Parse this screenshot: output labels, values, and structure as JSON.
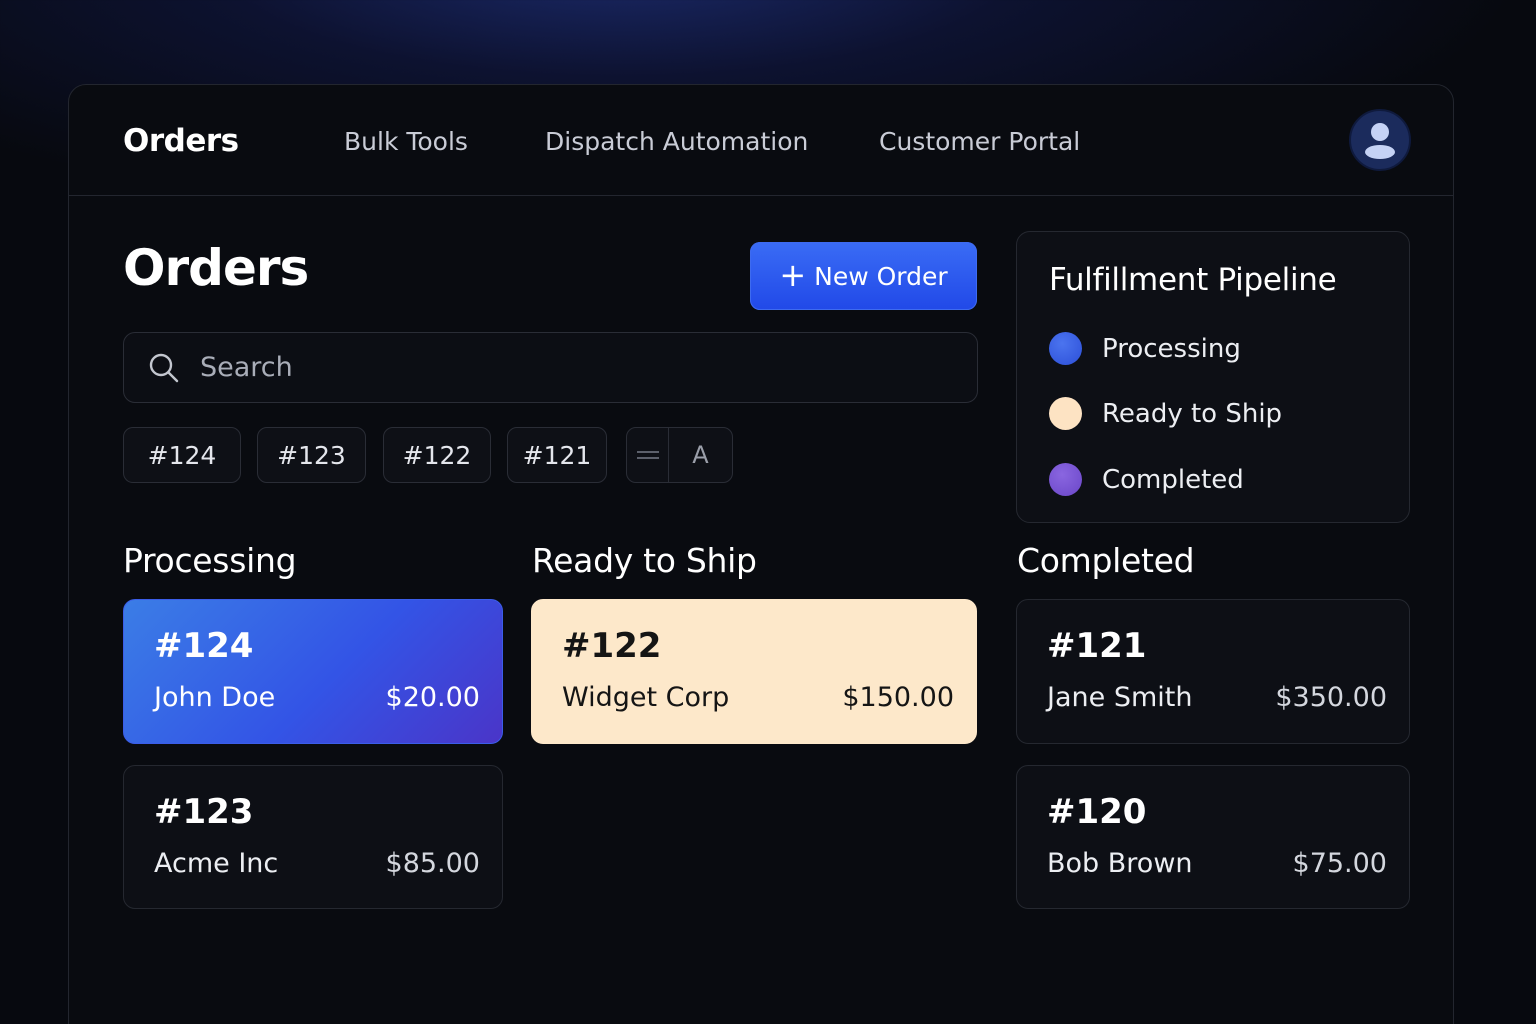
{
  "nav": {
    "brand": "Orders",
    "links": [
      "Bulk Tools",
      "Dispatch Automation",
      "Customer Portal"
    ],
    "avatar_icon": "user-icon"
  },
  "main": {
    "title": "Orders",
    "new_order_label": "New Order",
    "new_order_icon": "+",
    "search_placeholder": "Search",
    "chips": [
      "#124",
      "#123",
      "#122",
      "#121"
    ],
    "chip_group_icon": "equals-icon",
    "chip_group_label": "A"
  },
  "columns": [
    {
      "title": "Processing",
      "cards": [
        {
          "id": "#124",
          "customer": "John Doe",
          "amount": "$20.00"
        },
        {
          "id": "#123",
          "customer": "Acme Inc",
          "amount": "$85.00"
        }
      ]
    },
    {
      "title": "Ready to Ship",
      "cards": [
        {
          "id": "#122",
          "customer": "Widget Corp",
          "amount": "$150.00"
        }
      ]
    },
    {
      "title": "Completed",
      "cards": [
        {
          "id": "#121",
          "customer": "Jane Smith",
          "amount": "$350.00"
        },
        {
          "id": "#120",
          "customer": "Bob Brown",
          "amount": "$75.00"
        }
      ]
    }
  ],
  "pipeline": {
    "title": "Fulfillment Pipeline",
    "legend": [
      {
        "label": "Processing",
        "color": "#3a5fe6"
      },
      {
        "label": "Ready to Ship",
        "color": "#fde3c3"
      },
      {
        "label": "Completed",
        "color": "#7a56d6"
      }
    ]
  },
  "colors": {
    "accent": "#2f5cf0",
    "processing_card": "#3a5fe6",
    "ready_card": "#fde8ca",
    "background": "#07090f"
  }
}
